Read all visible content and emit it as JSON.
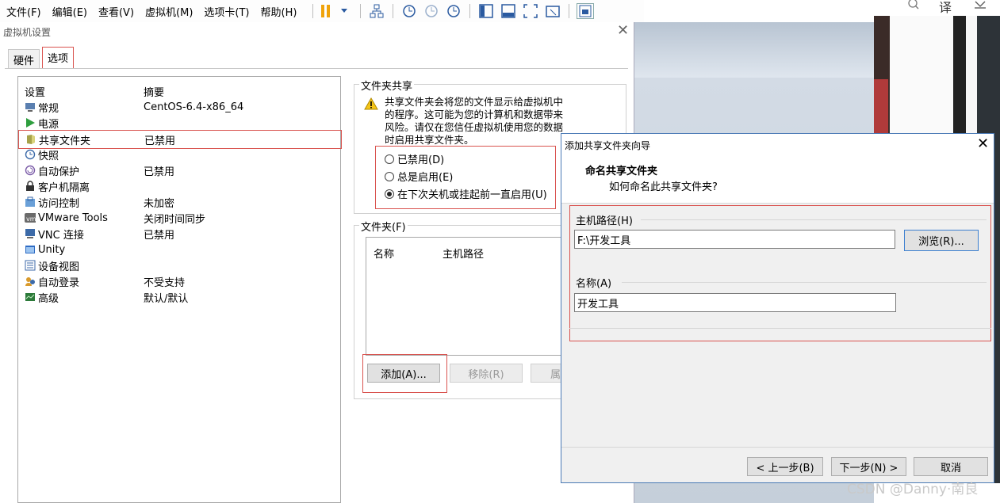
{
  "menubar": {
    "items": [
      "文件(F)",
      "编辑(E)",
      "查看(V)",
      "虚拟机(M)",
      "选项卡(T)",
      "帮助(H)"
    ]
  },
  "browser": {
    "translate": "译"
  },
  "settings": {
    "title": "虚拟机设置",
    "tabs": {
      "hardware": "硬件",
      "options": "选项"
    },
    "list_headers": {
      "setting": "设置",
      "summary": "摘要"
    },
    "items": [
      {
        "label": "常规",
        "summary": "CentOS-6.4-x86_64",
        "icon": "general-icon"
      },
      {
        "label": "电源",
        "summary": "",
        "icon": "power-icon"
      },
      {
        "label": "共享文件夹",
        "summary": "已禁用",
        "icon": "shared-folder-icon"
      },
      {
        "label": "快照",
        "summary": "",
        "icon": "snapshot-icon"
      },
      {
        "label": "自动保护",
        "summary": "已禁用",
        "icon": "autoprotect-icon"
      },
      {
        "label": "客户机隔离",
        "summary": "",
        "icon": "isolation-icon"
      },
      {
        "label": "访问控制",
        "summary": "未加密",
        "icon": "access-control-icon"
      },
      {
        "label": "VMware Tools",
        "summary": "关闭时间同步",
        "icon": "vmware-tools-icon"
      },
      {
        "label": "VNC 连接",
        "summary": "已禁用",
        "icon": "vnc-icon"
      },
      {
        "label": "Unity",
        "summary": "",
        "icon": "unity-icon"
      },
      {
        "label": "设备视图",
        "summary": "",
        "icon": "device-view-icon"
      },
      {
        "label": "自动登录",
        "summary": "不受支持",
        "icon": "autologin-icon"
      },
      {
        "label": "高级",
        "summary": "默认/默认",
        "icon": "advanced-icon"
      }
    ],
    "folder_sharing": {
      "title": "文件夹共享",
      "warning": [
        "共享文件夹会将您的文件显示给虚拟机中",
        "的程序。这可能为您的计算机和数据带来",
        "风险。请仅在您信任虚拟机使用您的数据",
        "时启用共享文件夹。"
      ],
      "options": [
        "已禁用(D)",
        "总是启用(E)",
        "在下次关机或挂起前一直启用(U)"
      ],
      "selected_index": 2
    },
    "folders": {
      "title": "文件夹(F)",
      "columns": {
        "name": "名称",
        "host_path": "主机路径"
      },
      "buttons": {
        "add": "添加(A)...",
        "remove": "移除(R)",
        "properties": "属"
      }
    }
  },
  "wizard": {
    "title": "添加共享文件夹向导",
    "heading": "命名共享文件夹",
    "subheading": "如何命名此共享文件夹?",
    "host_path_label": "主机路径(H)",
    "host_path_value": "F:\\开发工具",
    "browse_button": "浏览(R)...",
    "name_label": "名称(A)",
    "name_value": "开发工具",
    "buttons": {
      "back": "< 上一步(B)",
      "next": "下一步(N) >",
      "cancel": "取消"
    }
  },
  "watermark": "CSDN @Danny·南良"
}
